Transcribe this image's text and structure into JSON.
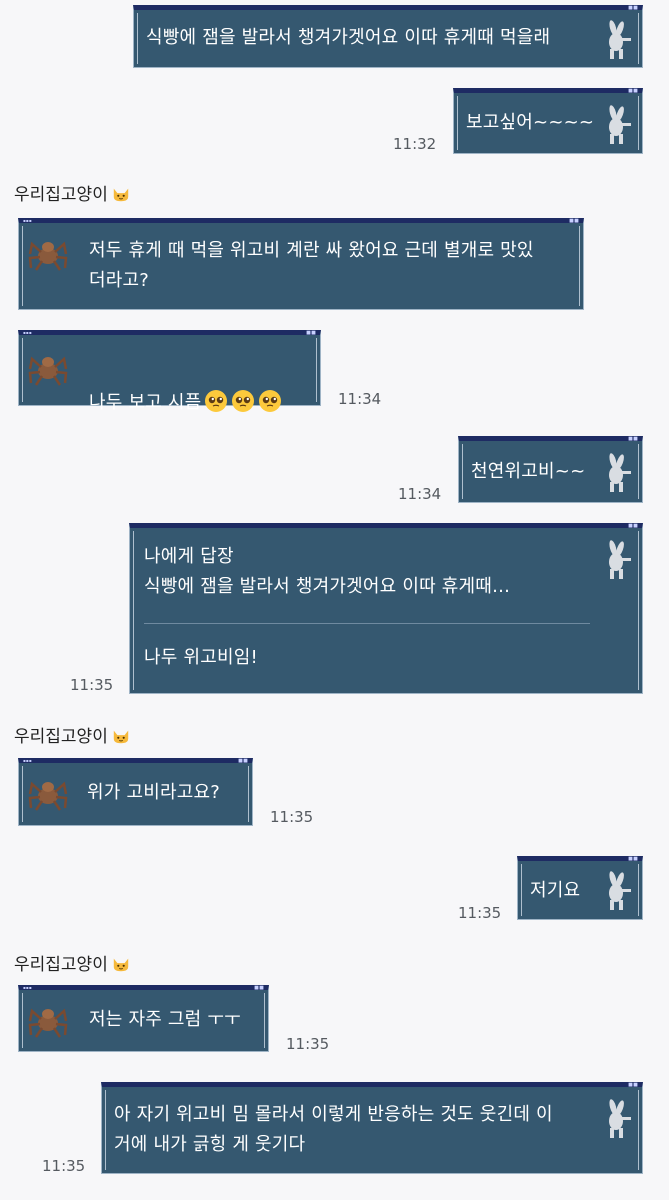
{
  "messages": {
    "m1": {
      "text": "식빵에 잼을 발라서 챙겨가겟어요 이따 휴게때 먹을래"
    },
    "m2": {
      "text": "보고싶어~~~~",
      "time": "11:32"
    },
    "m3": {
      "sender": "우리집고양이",
      "text": "저두 휴게 때 먹을 위고비 계란 싸 왔어요 근데 별개로 맛있\n더라고?"
    },
    "m4": {
      "text": "나두 보고 시픔",
      "time": "11:34"
    },
    "m5": {
      "text": "천연위고비~~",
      "time": "11:34"
    },
    "m6": {
      "reply_label": "나에게 답장",
      "quoted": "식빵에 잼을 발라서 챙겨가겟어요 이따 휴게때…",
      "text": "나두 위고비임!",
      "time": "11:35"
    },
    "m7": {
      "sender": "우리집고양이",
      "text": "위가 고비라고요?",
      "time": "11:35"
    },
    "m8": {
      "text": "저기요",
      "time": "11:35"
    },
    "m9": {
      "sender": "우리집고양이",
      "text": "저는 자주 그럼 ㅜㅜ",
      "time": "11:35"
    },
    "m10": {
      "text": "아 자기 위고비 밈 몰라서 이렇게 반응하는 것도 웃긴데 이\n거에 내가 긁힝 게 웃기다",
      "time": "11:35"
    }
  },
  "icons": {
    "bubble_icon_outgoing": "bunny-icon",
    "bubble_icon_incoming": "spider-icon",
    "sender_emoji": "cat-face-icon",
    "message_emoji": "pleading-face-icon"
  },
  "colors": {
    "background": "#f7f7f9",
    "bubble": "#355870",
    "bubble_border": "#1e2b63",
    "bubble_text": "#ffffff"
  }
}
